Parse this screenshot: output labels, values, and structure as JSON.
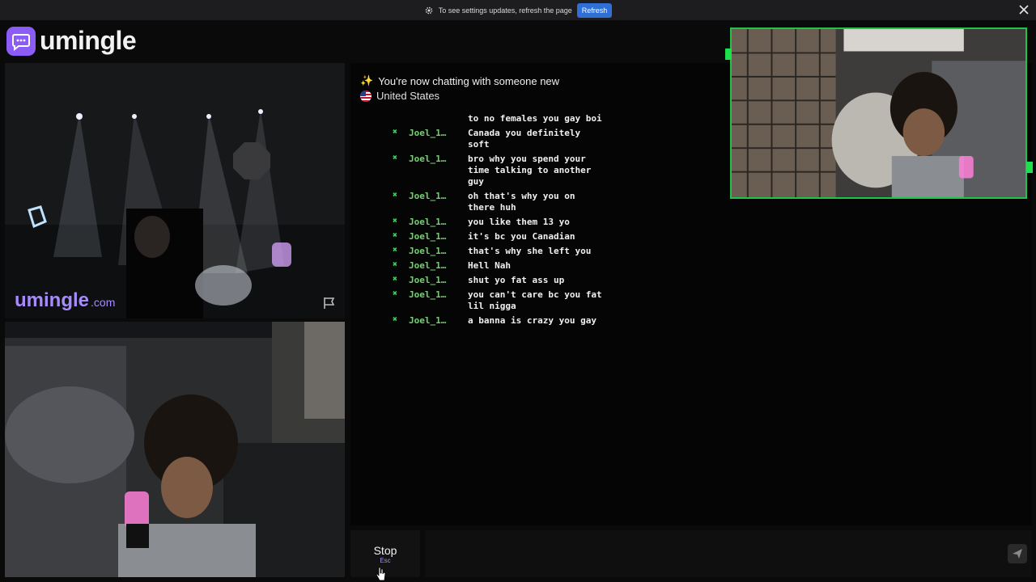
{
  "notification": {
    "message": "To see settings updates, refresh the page",
    "refresh_label": "Refresh"
  },
  "app": {
    "name": "umingle"
  },
  "stranger_video": {
    "watermark_name": "umingle",
    "watermark_domain": ".com"
  },
  "chat": {
    "status_icon": "sparkles-icon",
    "status_text": "You're now chatting with someone new",
    "country_flag": "us-flag-icon",
    "country": "United States",
    "partial_message": "to no females you gay boi",
    "messages": [
      {
        "user": "Joel_1…",
        "text": "Canada you definitely soft"
      },
      {
        "user": "Joel_1…",
        "text": "bro why you spend your time talking to another guy"
      },
      {
        "user": "Joel_1…",
        "text": "oh that's why you on there huh"
      },
      {
        "user": "Joel_1…",
        "text": "you like them 13 yo"
      },
      {
        "user": "Joel_1…",
        "text": "it's bc you Canadian"
      },
      {
        "user": "Joel_1…",
        "text": "that's why she left you"
      },
      {
        "user": "Joel_1…",
        "text": "Hell Nah"
      },
      {
        "user": "Joel_1…",
        "text": "shut yo fat ass up"
      },
      {
        "user": "Joel_1…",
        "text": "you can't care bc you fat lil nigga"
      },
      {
        "user": "Joel_1…",
        "text": "a banna is crazy you gay"
      }
    ]
  },
  "controls": {
    "stop_label": "Stop",
    "stop_shortcut": "Esc",
    "message_value": "",
    "message_placeholder": ""
  },
  "colors": {
    "accent": "#8b5cf6",
    "username": "#6fd56e",
    "pip_border": "#23c34a",
    "refresh": "#2f6fd6"
  }
}
